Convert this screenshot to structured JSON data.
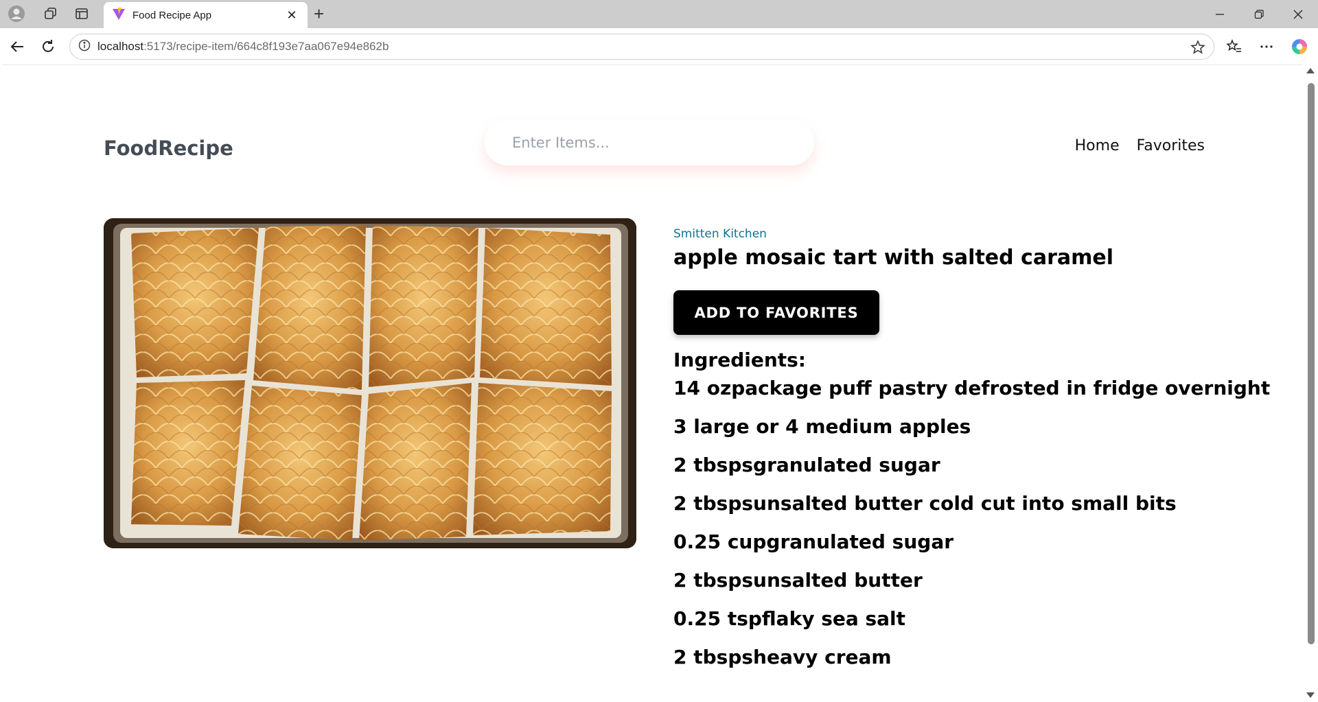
{
  "browser": {
    "tab_title": "Food Recipe App",
    "url_host": "localhost",
    "url_rest": ":5173/recipe-item/664c8f193e7aa067e94e862b"
  },
  "app": {
    "logo": "FoodRecipe",
    "search_placeholder": "Enter Items...",
    "nav": {
      "home": "Home",
      "favorites": "Favorites"
    }
  },
  "recipe": {
    "publisher": "Smitten Kitchen",
    "title": "apple mosaic tart with salted caramel",
    "add_to_favorites": "ADD TO FAVORITES",
    "ingredients_heading": "Ingredients:",
    "ingredients": [
      "14 ozpackage puff pastry defrosted in fridge overnight",
      "3 large or 4 medium apples",
      "2 tbspsgranulated sugar",
      "2 tbspsunsalted butter cold cut into small bits",
      "0.25 cupgranulated sugar",
      "2 tbspsunsalted butter",
      "0.25 tspflaky sea salt",
      "2 tbspsheavy cream"
    ]
  }
}
